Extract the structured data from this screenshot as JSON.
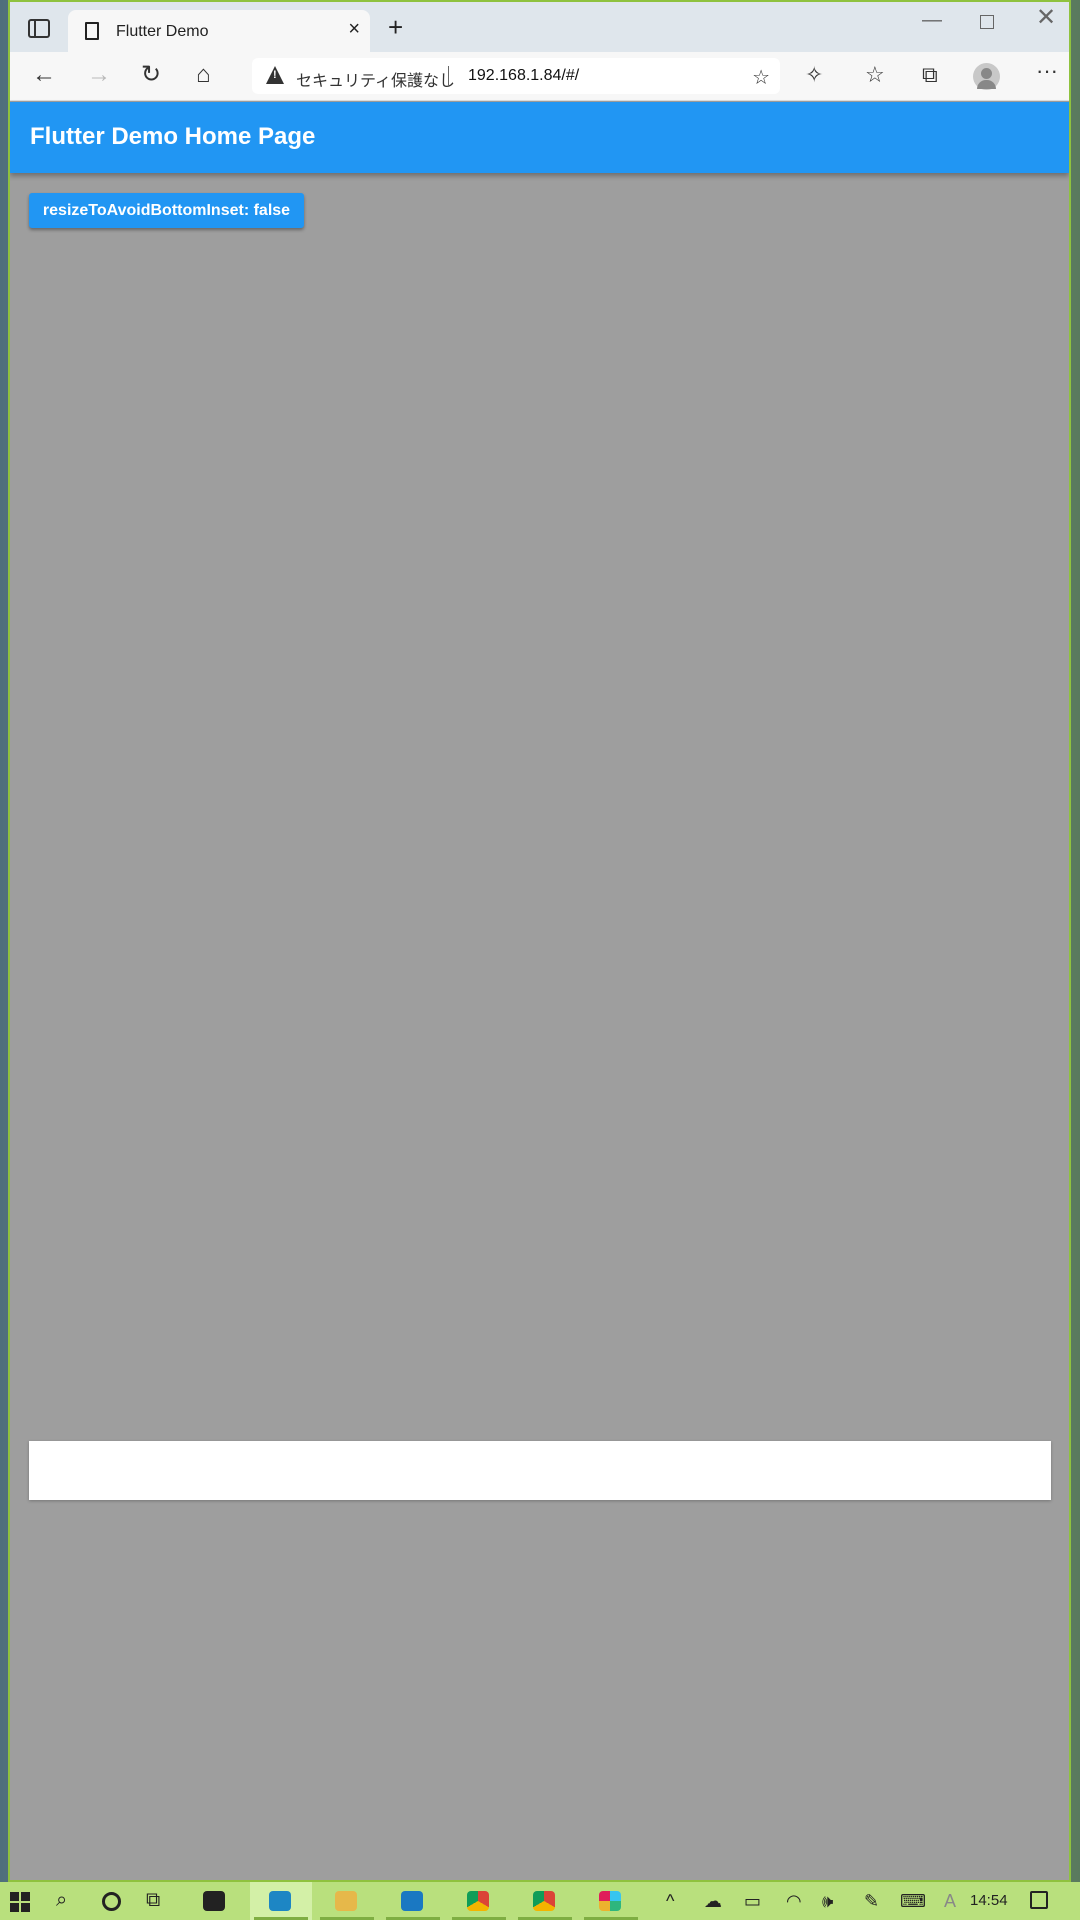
{
  "browser": {
    "tab_title": "Flutter Demo",
    "tab_close": "×",
    "new_tab": "+",
    "window_minimize": "—",
    "window_close": "✕",
    "security_label": "セキュリティ保護なし",
    "url": "192.168.1.84/#/",
    "back": "←",
    "forward": "→",
    "reload": "↻",
    "home": "⌂",
    "favorites_add": "☆",
    "extensions": "✧",
    "favorites": "☆",
    "collections": "⧉",
    "more": "···"
  },
  "app": {
    "appbar_title": "Flutter Demo Home Page",
    "button_label": "resizeToAvoidBottomInset: false",
    "text_field_value": ""
  },
  "taskbar": {
    "search": "⌕",
    "task_view": "⧉",
    "tray_chevron": "^",
    "onedrive": "☁",
    "battery": "▭",
    "wifi": "◠",
    "volume": "🕪",
    "pen": "✎",
    "keyboard": "⌨",
    "ime": "A",
    "time": "14:54"
  },
  "colors": {
    "primary": "#2196f3",
    "scaffold": "#9e9e9e",
    "taskbar": "#b9e07d"
  }
}
